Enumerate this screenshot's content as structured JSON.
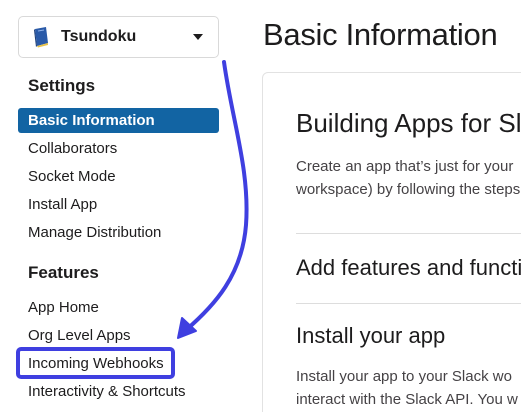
{
  "workspace": {
    "name": "Tsundoku"
  },
  "sidebar": {
    "settings_heading": "Settings",
    "settings_items": [
      {
        "label": "Basic Information",
        "active": true
      },
      {
        "label": "Collaborators"
      },
      {
        "label": "Socket Mode"
      },
      {
        "label": "Install App"
      },
      {
        "label": "Manage Distribution"
      }
    ],
    "features_heading": "Features",
    "features_items": [
      {
        "label": "App Home"
      },
      {
        "label": "Org Level Apps"
      },
      {
        "label": "Incoming Webhooks",
        "highlighted": true
      },
      {
        "label": "Interactivity & Shortcuts"
      }
    ]
  },
  "main": {
    "title": "Basic Information",
    "building_heading": "Building Apps for Slack",
    "building_text_line1": "Create an app that’s just for your",
    "building_text_line2": "workspace) by following the steps",
    "add_features_heading": "Add features and functionality",
    "install_heading": "Install your app",
    "install_text_line1": "Install your app to your Slack wo",
    "install_text_line2": "interact with the Slack API. You w"
  },
  "colors": {
    "active_bg": "#1264a3",
    "highlight": "#3f3fe0",
    "arrow": "#3f3fe0"
  },
  "icons": {
    "workspace": "book-icon",
    "dropdown": "caret-down-icon"
  }
}
